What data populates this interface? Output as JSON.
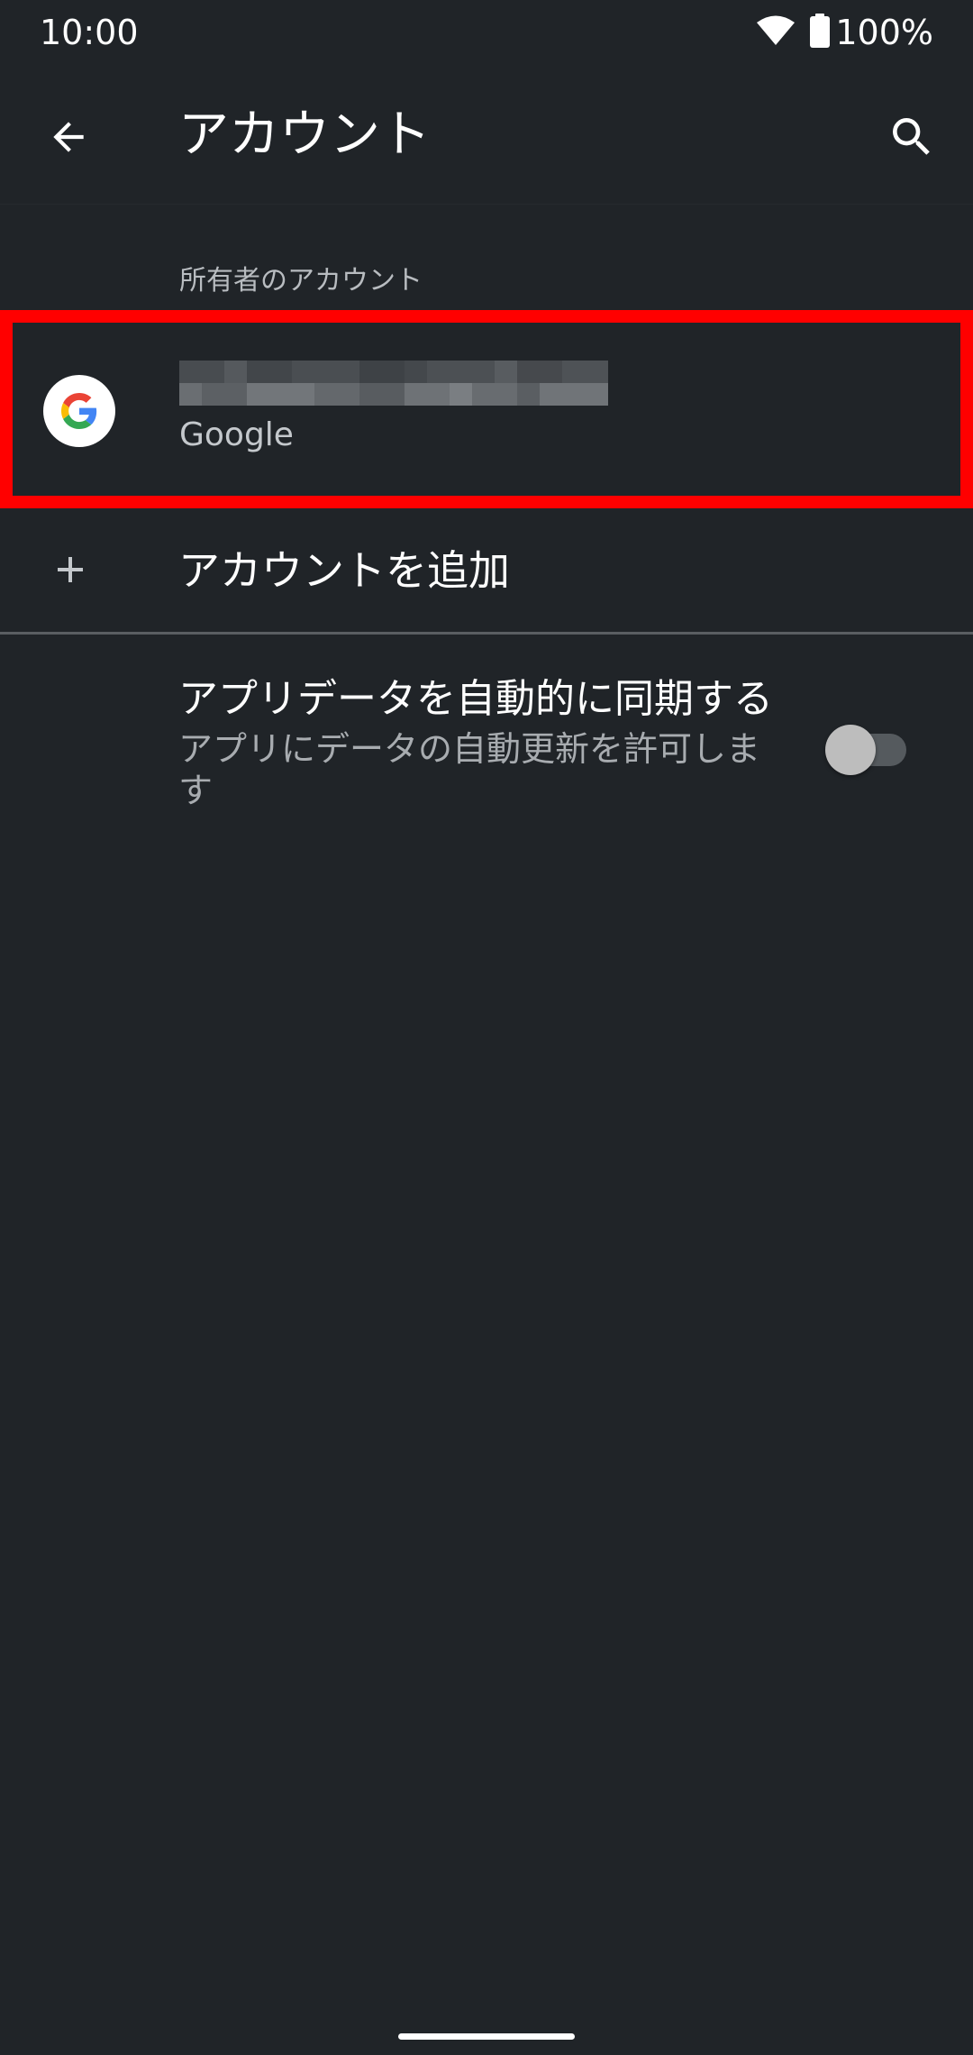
{
  "status_bar": {
    "time": "10:00",
    "battery": "100%",
    "icons": [
      "wifi-icon",
      "battery-icon"
    ]
  },
  "app_bar": {
    "title": "アカウント",
    "icons": [
      "back-arrow-icon",
      "search-icon"
    ]
  },
  "owner_section": {
    "header": "所有者のアカウント",
    "account": {
      "email": "",
      "type": "Google",
      "icon": "google-logo-icon",
      "highlight_color": "#ff0000"
    }
  },
  "add_account": {
    "label": "アカウントを追加",
    "icon": "plus-icon"
  },
  "auto_sync": {
    "title": "アプリデータを自動的に同期する",
    "summary": "アプリにデータの自動更新を許可します",
    "enabled": false
  },
  "colors": {
    "background": "#202428",
    "highlight": "#ff0000",
    "text_primary": "#ffffff",
    "text_secondary": "#a8acb0",
    "google_blue": "#4285F4",
    "google_red": "#EA4335",
    "google_yellow": "#FBBC05",
    "google_green": "#34A853"
  }
}
